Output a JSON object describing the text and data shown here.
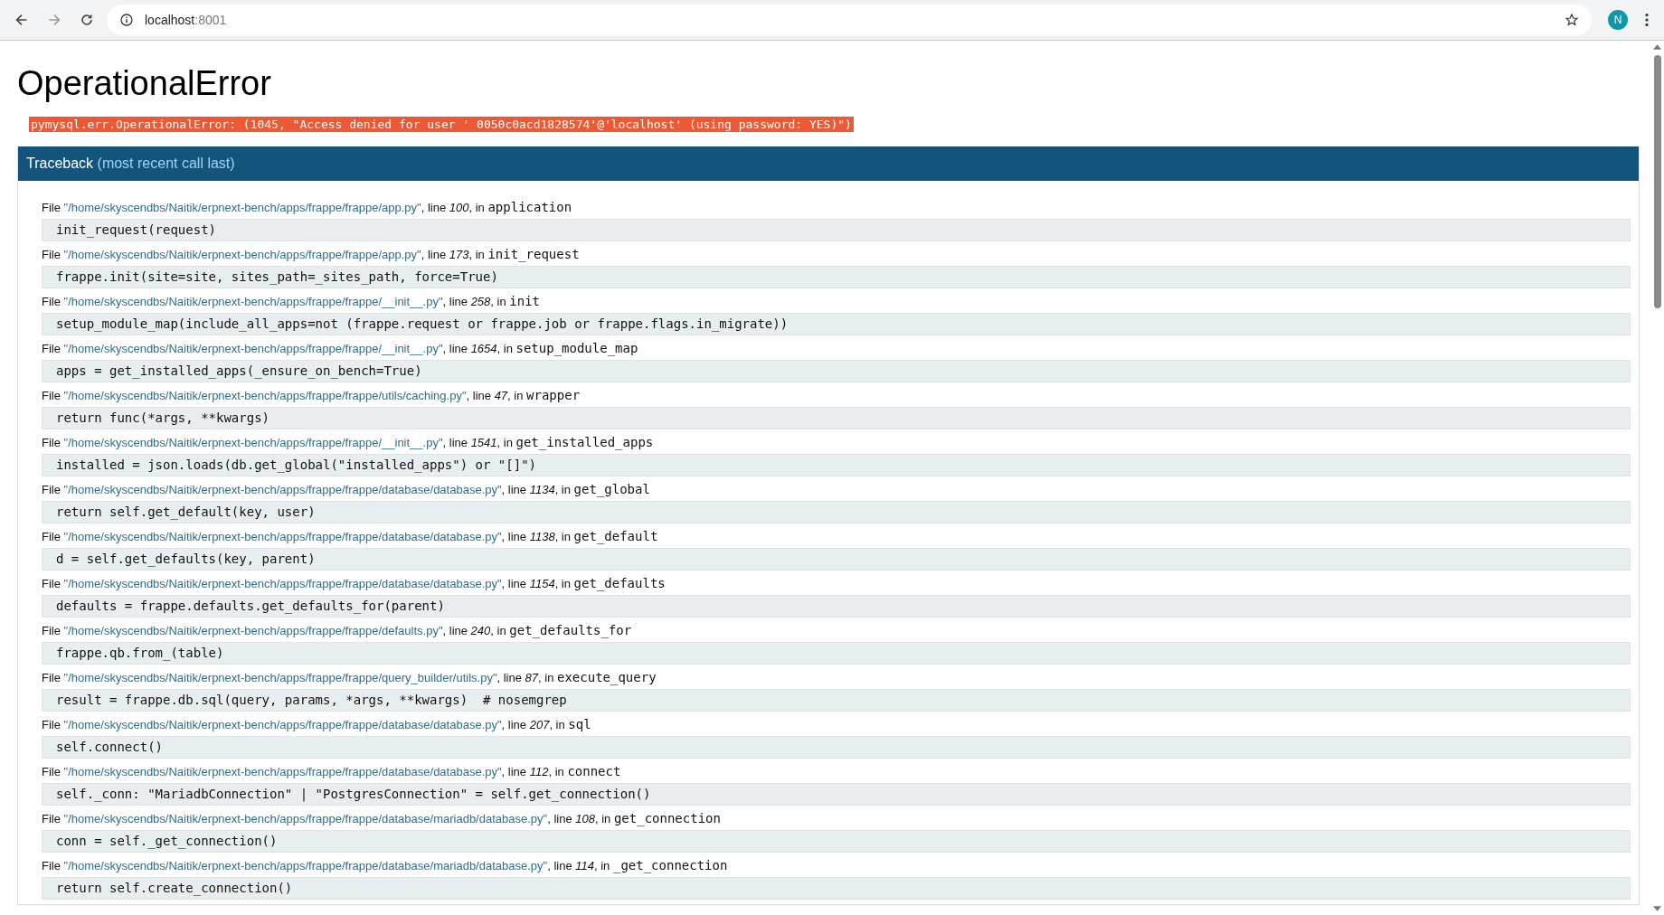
{
  "browser": {
    "url_host": "localhost",
    "url_port": ":8001",
    "profile_initial": "N"
  },
  "error": {
    "title": "OperationalError",
    "message": "pymysql.err.OperationalError: (1045, \"Access denied for user ' 0050c0acd1828574'@'localhost' (using password: YES)\")"
  },
  "traceback": {
    "title": "Traceback",
    "subtitle": "(most recent call last)",
    "frames": [
      {
        "prefix": "File",
        "file": "\"/home/skyscendbs/Naitik/erpnext-bench/apps/frappe/frappe/app.py\"",
        "line_label": ", line",
        "line": "100",
        "in_label": ", in",
        "function": "application",
        "code": "init_request(request)"
      },
      {
        "prefix": "File",
        "file": "\"/home/skyscendbs/Naitik/erpnext-bench/apps/frappe/frappe/app.py\"",
        "line_label": ", line",
        "line": "173",
        "in_label": ", in",
        "function": "init_request",
        "code": "frappe.init(site=site, sites_path=_sites_path, force=True)"
      },
      {
        "prefix": "File",
        "file": "\"/home/skyscendbs/Naitik/erpnext-bench/apps/frappe/frappe/__init__.py\"",
        "line_label": ", line",
        "line": "258",
        "in_label": ", in",
        "function": "init",
        "code": "setup_module_map(include_all_apps=not (frappe.request or frappe.job or frappe.flags.in_migrate))"
      },
      {
        "prefix": "File",
        "file": "\"/home/skyscendbs/Naitik/erpnext-bench/apps/frappe/frappe/__init__.py\"",
        "line_label": ", line",
        "line": "1654",
        "in_label": ", in",
        "function": "setup_module_map",
        "code": "apps = get_installed_apps(_ensure_on_bench=True)"
      },
      {
        "prefix": "File",
        "file": "\"/home/skyscendbs/Naitik/erpnext-bench/apps/frappe/frappe/utils/caching.py\"",
        "line_label": ", line",
        "line": "47",
        "in_label": ", in",
        "function": "wrapper",
        "code": "return func(*args, **kwargs)"
      },
      {
        "prefix": "File",
        "file": "\"/home/skyscendbs/Naitik/erpnext-bench/apps/frappe/frappe/__init__.py\"",
        "line_label": ", line",
        "line": "1541",
        "in_label": ", in",
        "function": "get_installed_apps",
        "code": "installed = json.loads(db.get_global(\"installed_apps\") or \"[]\")"
      },
      {
        "prefix": "File",
        "file": "\"/home/skyscendbs/Naitik/erpnext-bench/apps/frappe/frappe/database/database.py\"",
        "line_label": ", line",
        "line": "1134",
        "in_label": ", in",
        "function": "get_global",
        "code": "return self.get_default(key, user)"
      },
      {
        "prefix": "File",
        "file": "\"/home/skyscendbs/Naitik/erpnext-bench/apps/frappe/frappe/database/database.py\"",
        "line_label": ", line",
        "line": "1138",
        "in_label": ", in",
        "function": "get_default",
        "code": "d = self.get_defaults(key, parent)"
      },
      {
        "prefix": "File",
        "file": "\"/home/skyscendbs/Naitik/erpnext-bench/apps/frappe/frappe/database/database.py\"",
        "line_label": ", line",
        "line": "1154",
        "in_label": ", in",
        "function": "get_defaults",
        "code": "defaults = frappe.defaults.get_defaults_for(parent)"
      },
      {
        "prefix": "File",
        "file": "\"/home/skyscendbs/Naitik/erpnext-bench/apps/frappe/frappe/defaults.py\"",
        "line_label": ", line",
        "line": "240",
        "in_label": ", in",
        "function": "get_defaults_for",
        "code": "frappe.qb.from_(table)"
      },
      {
        "prefix": "File",
        "file": "\"/home/skyscendbs/Naitik/erpnext-bench/apps/frappe/frappe/query_builder/utils.py\"",
        "line_label": ", line",
        "line": "87",
        "in_label": ", in",
        "function": "execute_query",
        "code": "result = frappe.db.sql(query, params, *args, **kwargs)  # nosemgrep"
      },
      {
        "prefix": "File",
        "file": "\"/home/skyscendbs/Naitik/erpnext-bench/apps/frappe/frappe/database/database.py\"",
        "line_label": ", line",
        "line": "207",
        "in_label": ", in",
        "function": "sql",
        "code": "self.connect()"
      },
      {
        "prefix": "File",
        "file": "\"/home/skyscendbs/Naitik/erpnext-bench/apps/frappe/frappe/database/database.py\"",
        "line_label": ", line",
        "line": "112",
        "in_label": ", in",
        "function": "connect",
        "code": "self._conn: \"MariadbConnection\" | \"PostgresConnection\" = self.get_connection()"
      },
      {
        "prefix": "File",
        "file": "\"/home/skyscendbs/Naitik/erpnext-bench/apps/frappe/frappe/database/mariadb/database.py\"",
        "line_label": ", line",
        "line": "108",
        "in_label": ", in",
        "function": "get_connection",
        "code": "conn = self._get_connection()"
      },
      {
        "prefix": "File",
        "file": "\"/home/skyscendbs/Naitik/erpnext-bench/apps/frappe/frappe/database/mariadb/database.py\"",
        "line_label": ", line",
        "line": "114",
        "in_label": ", in",
        "function": "_get_connection",
        "code": "return self.create_connection()"
      }
    ]
  }
}
